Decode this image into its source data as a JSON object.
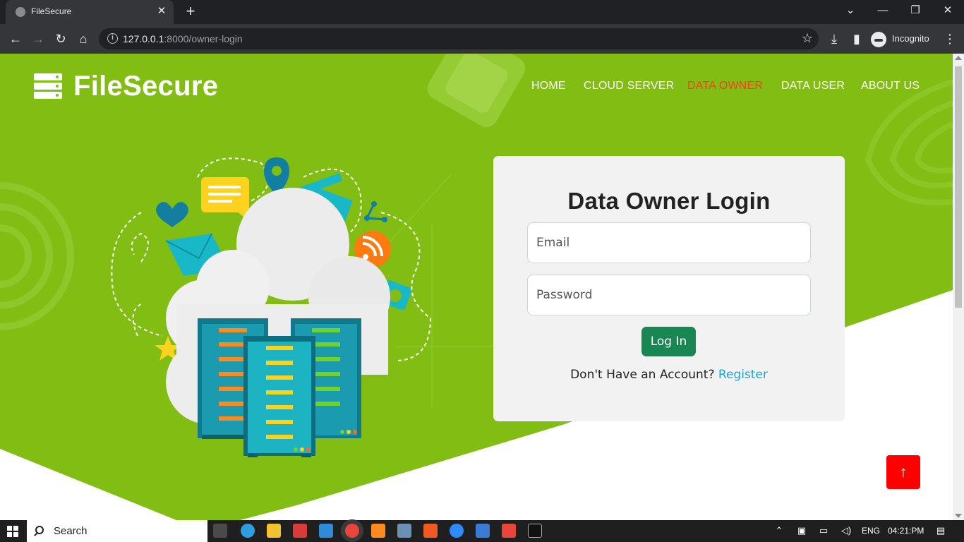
{
  "browser": {
    "tab_title": "FileSecure",
    "url_host": "127.0.0.1",
    "url_rest": ":8000/owner-login",
    "profile_label": "Incognito"
  },
  "site": {
    "brand": "FileSecure",
    "nav": [
      {
        "label": "HOME"
      },
      {
        "label": "CLOUD SERVER"
      },
      {
        "label": "DATA OWNER"
      },
      {
        "label": "DATA USER"
      },
      {
        "label": "ABOUT US"
      }
    ],
    "active_nav": "DATA OWNER"
  },
  "login": {
    "title": "Data Owner Login",
    "email_placeholder": "Email",
    "password_placeholder": "Password",
    "submit_label": "Log In",
    "register_prompt": "Don't Have an Account?",
    "register_link": "Register"
  },
  "colors": {
    "hero_green": "#81bd12",
    "active_nav": "#f54216",
    "button_green": "#198754",
    "back_to_top": "#ff0000",
    "register_link": "#1fa4d8"
  },
  "taskbar": {
    "search_label": "Search",
    "language": "ENG",
    "time": "04:21:PM"
  },
  "icons": {
    "back_to_top": "arrow-up-icon",
    "logo": "server-stack-icon"
  }
}
